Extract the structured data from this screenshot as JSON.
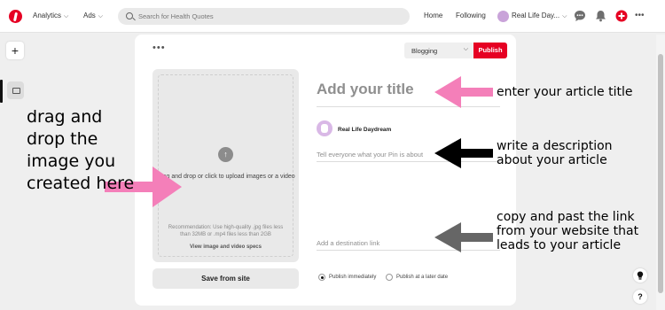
{
  "nav": {
    "analytics": "Analytics",
    "ads": "Ads",
    "search_placeholder": "Search for Health Quotes",
    "home": "Home",
    "following": "Following",
    "profile_name": "Real Life Day...",
    "more": "•••"
  },
  "rail": {
    "plus": "+"
  },
  "card": {
    "more": "•••",
    "board": "Blogging",
    "publish": "Publish",
    "drop_text": "Drag and drop or click to upload images or a video",
    "recommendation": "Recommendation: Use high-quality .jpg files less than 32MB or .mp4 files less than 2GB",
    "specs_link": "View image and video specs",
    "save_from_site": "Save from site",
    "title_placeholder": "Add your title",
    "author": "Real Life Daydream",
    "description_placeholder": "Tell everyone what your Pin is about",
    "link_placeholder": "Add a destination link",
    "publish_now": "Publish immediately",
    "publish_later": "Publish at a later date"
  },
  "help": {
    "tip": "?",
    "bulb": "💡"
  },
  "annotations": {
    "drag": "drag and drop the image you created here",
    "title": "enter your article title",
    "description": "write a description about your article",
    "link": "copy and past the link from your website that leads to your article"
  },
  "colors": {
    "brand_red": "#e60023",
    "arrow_pink": "#f47fb9",
    "arrow_black": "#000000",
    "arrow_gray": "#666666"
  }
}
